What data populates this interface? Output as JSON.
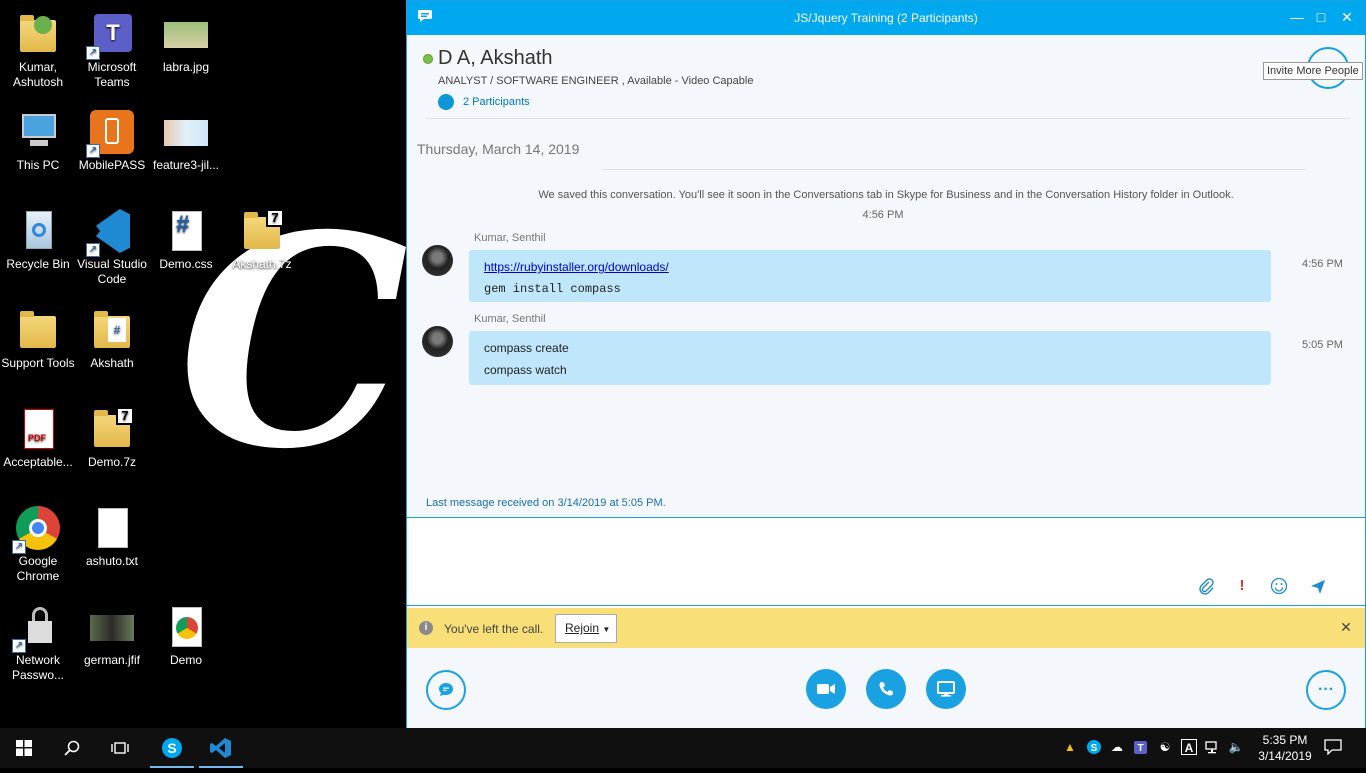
{
  "desktop": {
    "wallpaper_text": "Cap",
    "icons": [
      {
        "label": "Kumar, Ashutosh"
      },
      {
        "label": "Microsoft Teams"
      },
      {
        "label": "labra.jpg"
      },
      {
        "label": "This PC"
      },
      {
        "label": "MobilePASS"
      },
      {
        "label": "feature3-jil..."
      },
      {
        "label": "Recycle Bin"
      },
      {
        "label": "Visual Studio Code"
      },
      {
        "label": "Demo.css"
      },
      {
        "label": "Akshath.7z"
      },
      {
        "label": "Support Tools"
      },
      {
        "label": "Akshath"
      },
      {
        "label": "Acceptable..."
      },
      {
        "label": "Demo.7z"
      },
      {
        "label": "Google Chrome"
      },
      {
        "label": "ashuto.txt"
      },
      {
        "label": "Network Passwo..."
      },
      {
        "label": "german.jfif"
      },
      {
        "label": "Demo"
      }
    ]
  },
  "skype": {
    "window_title": "JS/Jquery Training (2 Participants)",
    "contact_name": "D A, Akshath",
    "contact_sub": "ANALYST  / SOFTWARE ENGINEER ,  Available - Video Capable",
    "participants_label": "2 Participants",
    "invite_tooltip": "Invite More People",
    "date_heading": "Thursday, March 14, 2019",
    "system_message": "We saved this conversation. You'll see it soon in the Conversations tab in Skype for Business and in the Conversation History folder in Outlook.",
    "system_time": "4:56 PM",
    "messages": [
      {
        "sender": "Kumar, Senthil",
        "time": "4:56 PM",
        "link": "https://rubyinstaller.org/downloads/",
        "line2": "gem install compass"
      },
      {
        "sender": "Kumar, Senthil",
        "time": "5:05 PM",
        "line1": "compass create",
        "line2": "compass watch"
      }
    ],
    "last_message": "Last message received on 3/14/2019 at 5:05 PM.",
    "banner_text": "You've left the call.",
    "rejoin_label": "Rejoin",
    "more_label": "···"
  },
  "taskbar": {
    "time": "5:35 PM",
    "date": "3/14/2019"
  },
  "colors": {
    "accent": "#00a8f0",
    "bubble": "#bfe6fa",
    "banner": "#f8df77",
    "presence": "#7ac142"
  }
}
